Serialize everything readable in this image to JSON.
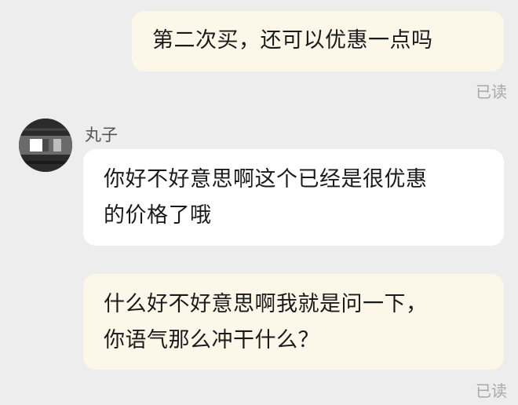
{
  "messages": [
    {
      "text": "第二次买，还可以优惠一点吗",
      "status": "已读"
    },
    {
      "sender": "丸子",
      "line1": "你好不好意思啊这个已经是很优惠",
      "line2": "的价格了哦"
    },
    {
      "line1": "什么好不好意思啊我就是问一下，",
      "line2": "你语气那么冲干什么？",
      "status": "已读"
    }
  ]
}
